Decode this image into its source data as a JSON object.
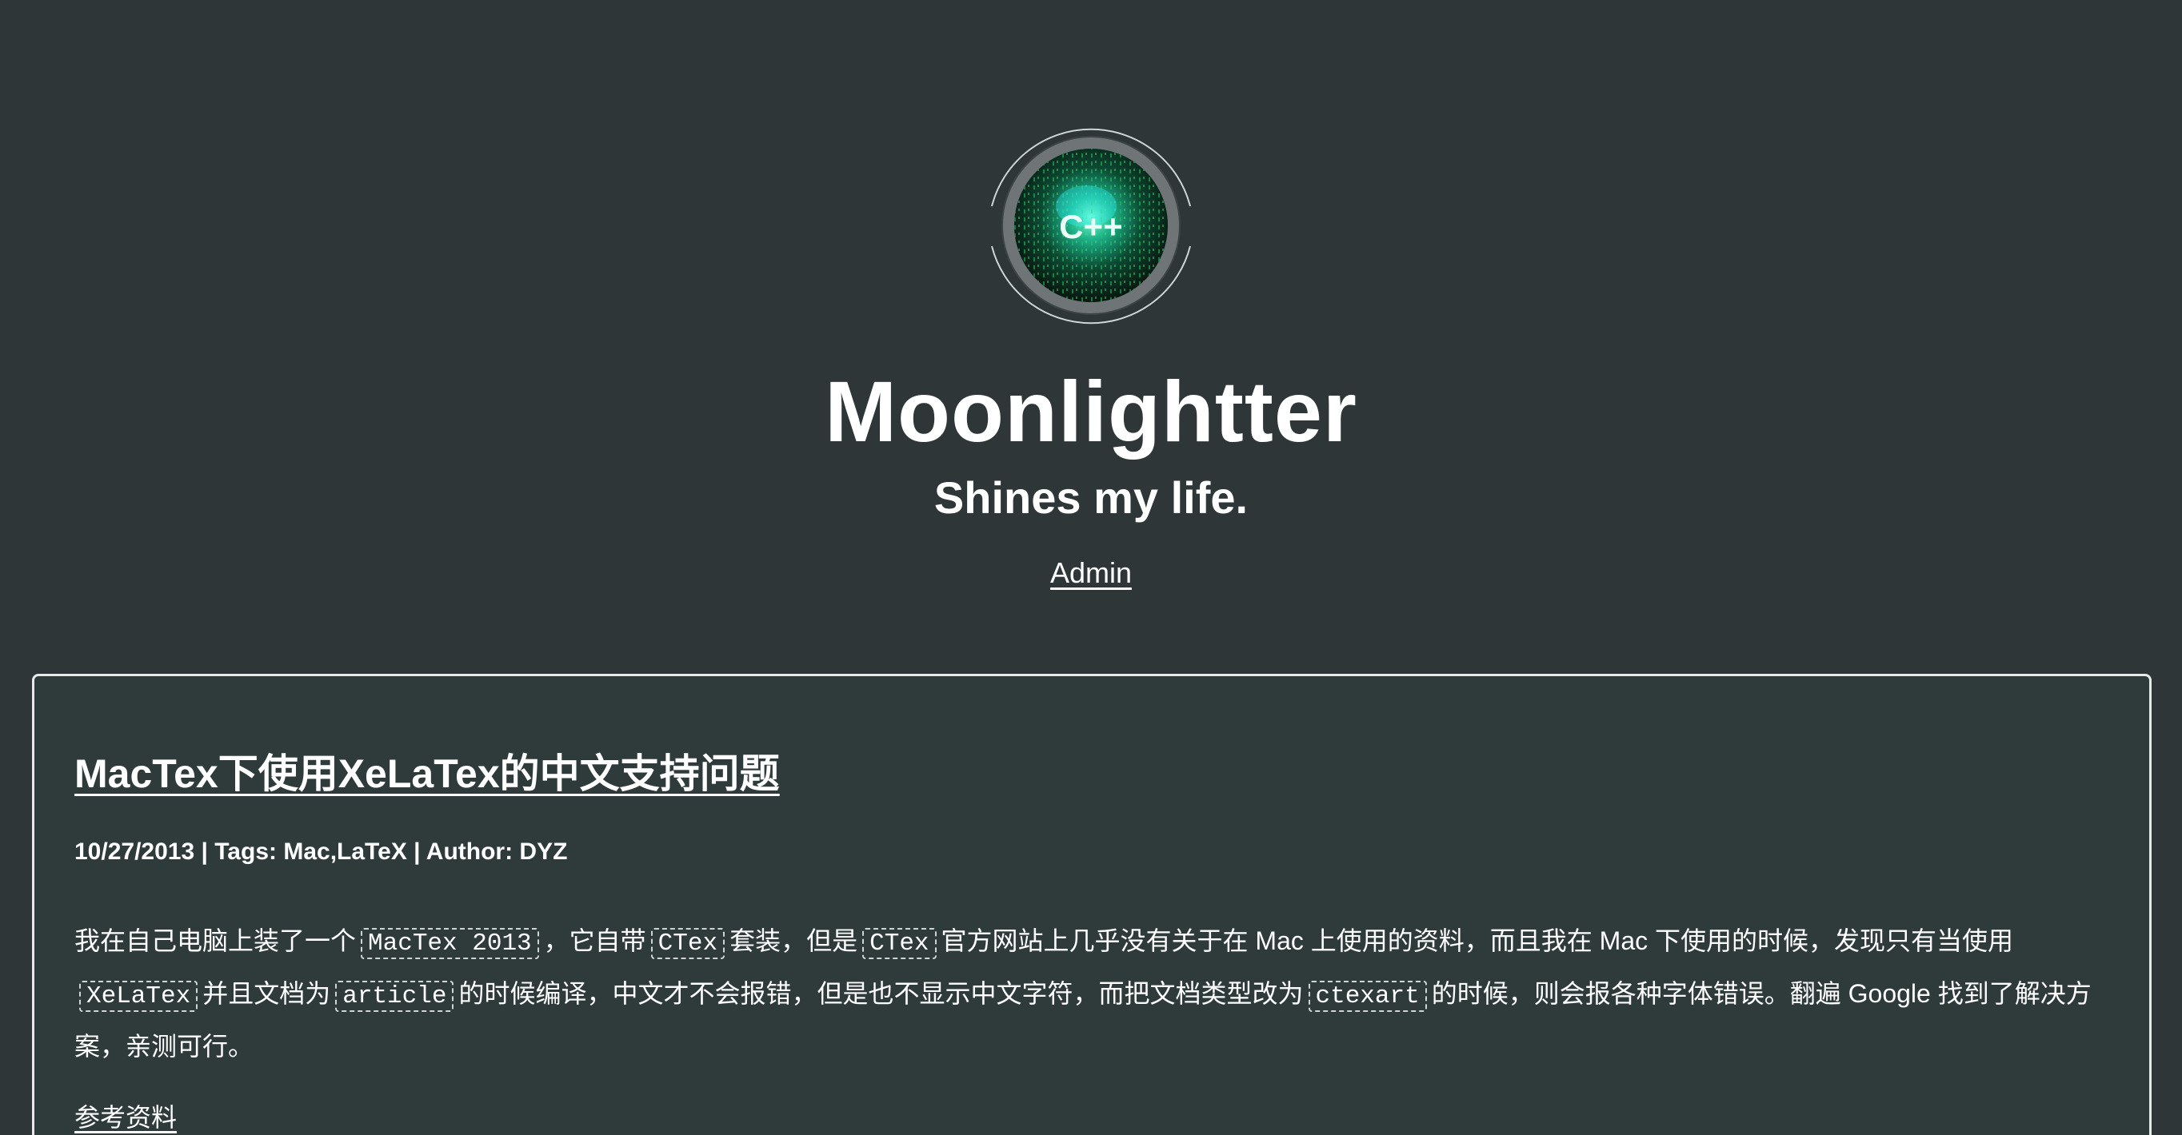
{
  "header": {
    "avatar_text": "C++",
    "site_title": "Moonlightter",
    "subtitle": "Shines my life.",
    "admin_link": "Admin"
  },
  "post": {
    "title": "MacTex下使用XeLaTex的中文支持问题",
    "meta": "10/27/2013 | Tags: Mac,LaTeX | Author: DYZ",
    "body": {
      "t1": "我在自己电脑上装了一个",
      "c1": "MacTex 2013",
      "t2": "，它自带",
      "c2": "CTex",
      "t3": "套装，但是",
      "c3": "CTex",
      "t4": "官方网站上几乎没有关于在 Mac 上使用的资料，而且我在 Mac 下使用的时候，发现只有当使用",
      "c4": "XeLaTex",
      "t5": "并且文档为",
      "c5": "article",
      "t6": "的时候编译，中文才不会报错，但是也不显示中文字符，而把文档类型改为",
      "c6": "ctexart",
      "t7": "的时候，则会报各种字体错误。翻遍 Google 找到了解决方案，亲测可行。"
    },
    "refs_link": "参考资料"
  },
  "colors": {
    "background": "#2e3638",
    "card_border": "#e8eaea",
    "text": "#ffffff"
  }
}
